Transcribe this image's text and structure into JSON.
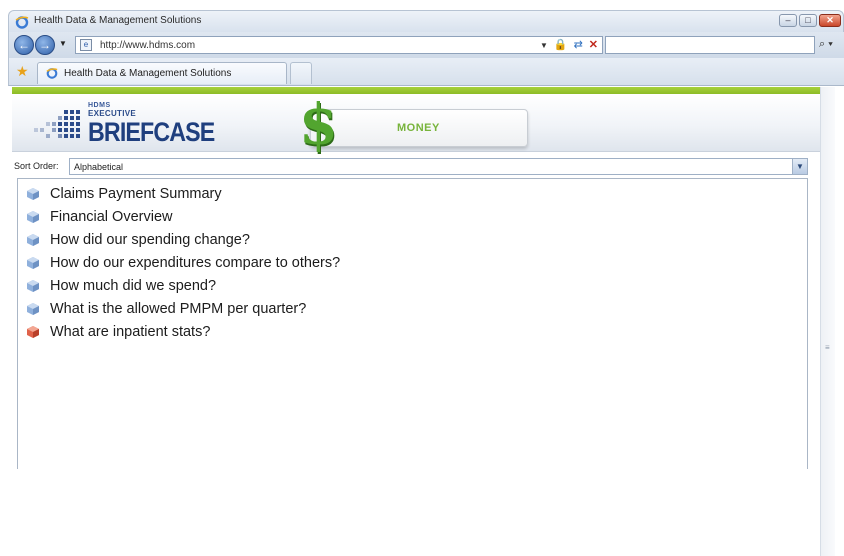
{
  "window": {
    "title": "Health Data & Management Solutions",
    "buttons": {
      "minimize": "–",
      "maximize": "□",
      "close": "✕"
    }
  },
  "address_bar": {
    "url": "http://www.hdms.com",
    "search_placeholder": ""
  },
  "tabs": [
    {
      "label": "Health Data & Management Solutions"
    }
  ],
  "header": {
    "logo_small": "HDMS",
    "logo_mid": "EXECUTIVE",
    "logo_main": "BRIEFCASE"
  },
  "money_button": {
    "symbol": "$",
    "label": "MONEY"
  },
  "sort": {
    "label": "Sort Order:",
    "value": "Alphabetical"
  },
  "reports": [
    {
      "label": "Claims Payment Summary",
      "icon": "blue-gem-icon"
    },
    {
      "label": "Financial Overview",
      "icon": "blue-gem-icon"
    },
    {
      "label": "How did our spending change?",
      "icon": "blue-gem-icon"
    },
    {
      "label": "How do our expenditures compare to others?",
      "icon": "blue-gem-icon"
    },
    {
      "label": "How much did we spend?",
      "icon": "blue-gem-icon"
    },
    {
      "label": "What is the allowed PMPM per quarter?",
      "icon": "blue-gem-icon"
    },
    {
      "label": "What are inpatient stats?",
      "icon": "red-gem-icon"
    }
  ],
  "colors": {
    "accent_green": "#8cbb26",
    "logo_blue": "#1f3f7e",
    "gem_blue": "#8fb0dc",
    "gem_red": "#e0624a"
  }
}
